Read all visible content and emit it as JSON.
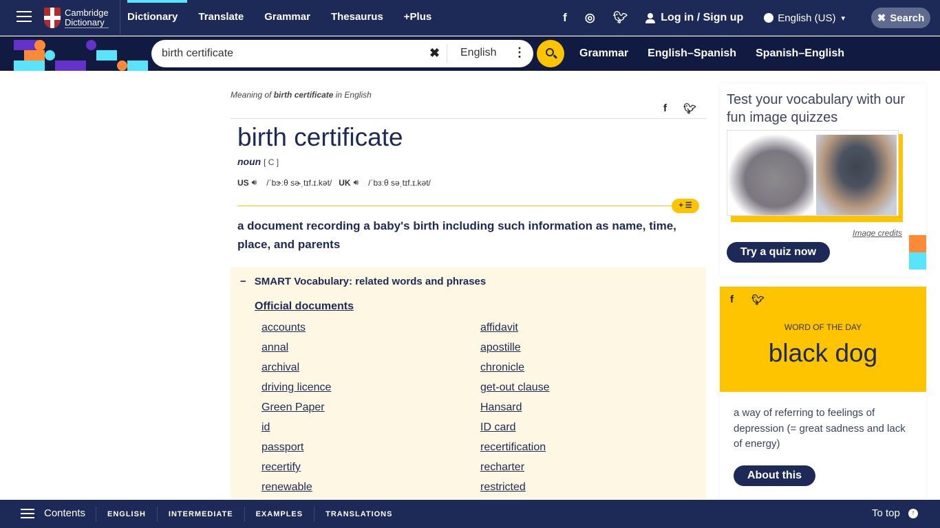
{
  "topnav": {
    "logo": {
      "line1": "Cambridge",
      "line2": "Dictionary"
    },
    "links": [
      {
        "label": "Dictionary",
        "active": true
      },
      {
        "label": "Translate"
      },
      {
        "label": "Grammar"
      },
      {
        "label": "Thesaurus"
      },
      {
        "label": "+Plus"
      }
    ],
    "social_icons": [
      "facebook-icon",
      "instagram-icon",
      "twitter-icon"
    ],
    "login_label": "Log in / Sign up",
    "language_label": "English (US)",
    "search_toggle_label": "Search"
  },
  "searchbar": {
    "value": "birth certificate",
    "dictionary": "English",
    "links": [
      "Grammar",
      "English–Spanish",
      "Spanish–English"
    ]
  },
  "entry": {
    "meaning_prefix": "Meaning of ",
    "meaning_word": "birth certificate",
    "meaning_suffix": " in English",
    "headword": "birth certificate",
    "pos": "noun",
    "grammar": "[ C ]",
    "us_label": "US",
    "us_ipa": "/ˈbɝːθ sɚˌtɪf.ɪ.kət/",
    "uk_label": "UK",
    "uk_ipa": "/ˈbɜːθ səˌtɪf.ɪ.kət/",
    "add_button": "+ ☰",
    "definition": "a document recording a baby's birth including such information as name, time, place, and parents"
  },
  "smart_vocab": {
    "title": "SMART Vocabulary: related words and phrases",
    "topic": "Official documents",
    "col1": [
      "accounts",
      "annal",
      "archival",
      "driving licence",
      "Green Paper",
      "id",
      "passport",
      "recertify",
      "renewable"
    ],
    "col2": [
      "affidavit",
      "apostille",
      "chronicle",
      "get-out clause",
      "Hansard",
      "ID card",
      "recertification",
      "recharter",
      "restricted"
    ]
  },
  "quiz": {
    "title": "Test your vocabulary with our fun image quizzes",
    "credits": "Image credits",
    "button": "Try a quiz now"
  },
  "wotd": {
    "label": "WORD OF THE DAY",
    "word": "black dog",
    "definition": "a way of referring to feelings of depression (= great sadness and lack of energy)",
    "button": "About this"
  },
  "bottombar": {
    "contents": "Contents",
    "tabs": [
      "ENGLISH",
      "INTERMEDIATE",
      "EXAMPLES",
      "TRANSLATIONS"
    ],
    "to_top": "To top"
  },
  "colors": {
    "navy": "#1d2a57",
    "dark_navy": "#111a40",
    "yellow": "#fec400",
    "cyan": "#5ae4fb",
    "orange": "#fc8935",
    "purple": "#6432c8",
    "smart_bg": "#fef7e3"
  }
}
